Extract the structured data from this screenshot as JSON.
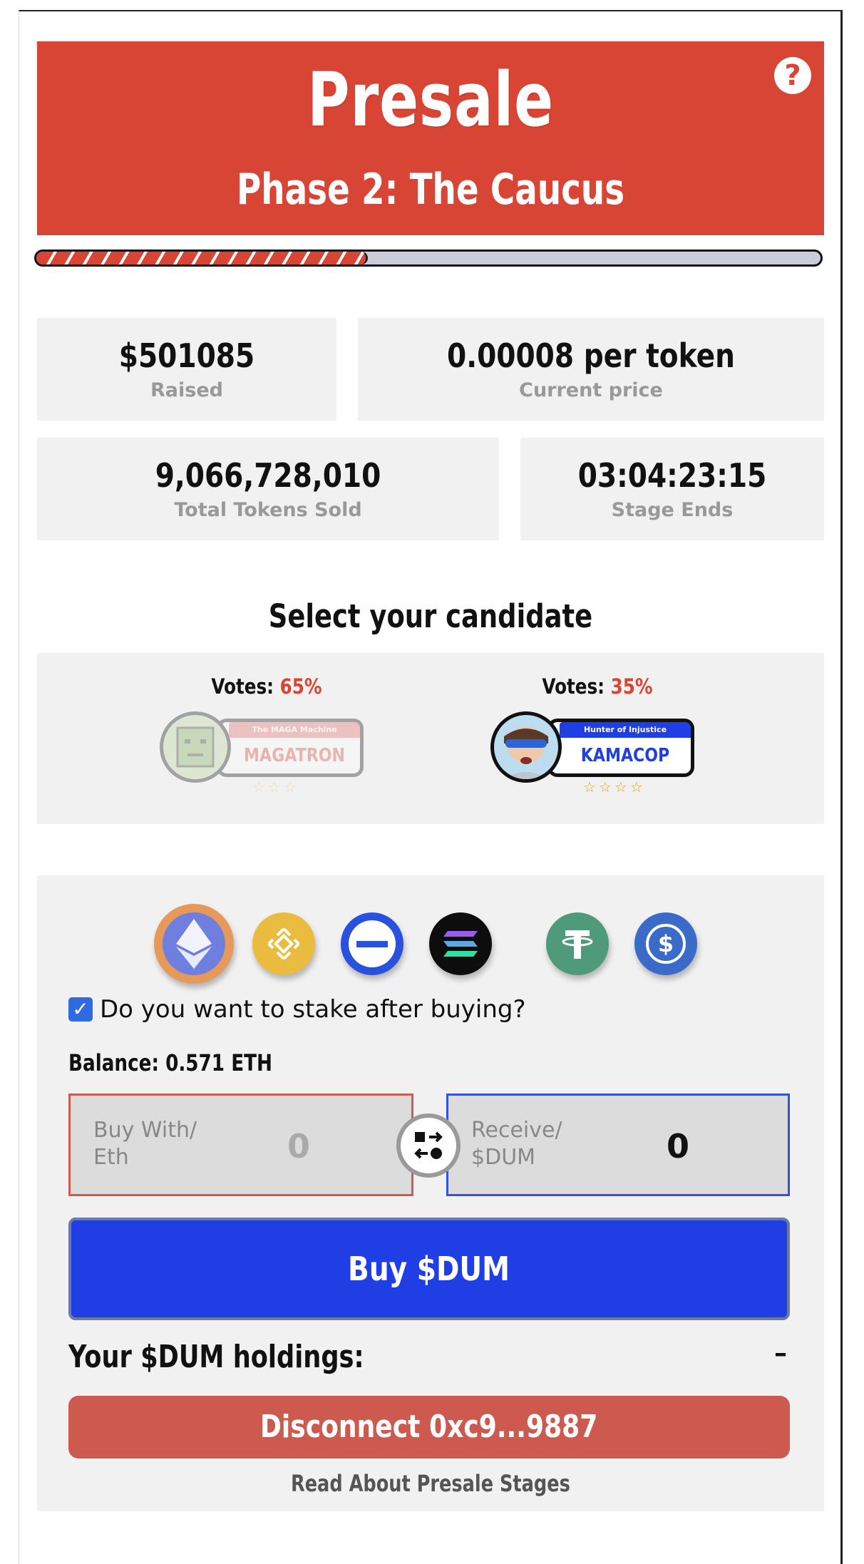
{
  "hero": {
    "title": "Presale",
    "subtitle": "Phase 2: The Caucus",
    "help_icon": "?"
  },
  "progress": {
    "fraction": 0.42,
    "fill_color": "#d84535"
  },
  "stats": {
    "raised": {
      "value": "$501085",
      "label": "Raised"
    },
    "price": {
      "value": "0.00008 per token",
      "label": "Current price"
    },
    "sold": {
      "value": "9,066,728,010",
      "label": "Total Tokens Sold"
    },
    "ends": {
      "value": "03:04:23:15",
      "label": "Stage Ends"
    }
  },
  "candidates": {
    "title": "Select your candidate",
    "items": [
      {
        "votes_label": "Votes:",
        "pct": "65%",
        "tag": "The MAGA Machine",
        "name": "MAGATRON",
        "stars": "☆☆☆"
      },
      {
        "votes_label": "Votes:",
        "pct": "35%",
        "tag": "Hunter of Injustice",
        "name": "KAMACOP",
        "stars": "☆☆☆☆"
      }
    ]
  },
  "buy": {
    "coins": [
      "ethereum-icon",
      "bnb-icon",
      "base-icon",
      "solana-icon",
      "tether-icon",
      "usdc-icon"
    ],
    "stake_label": "Do you want to stake after buying?",
    "balance": "Balance: 0.571 ETH",
    "pay_label": "Buy With/\nEth",
    "pay_value": "0",
    "receive_label": "Receive/\n$DUM",
    "receive_value": "0",
    "buy_button": "Buy $DUM",
    "holdings_label": "Your $DUM holdings:",
    "holdings_value": "–",
    "disconnect_button": "Disconnect 0xc9...9887",
    "read_link": "Read About Presale Stages"
  },
  "colors": {
    "brand_red": "#d84535",
    "buy_blue": "#1f3fe5",
    "disconnect_red": "#cc5a4f",
    "card_bg": "#f1f1f1"
  }
}
